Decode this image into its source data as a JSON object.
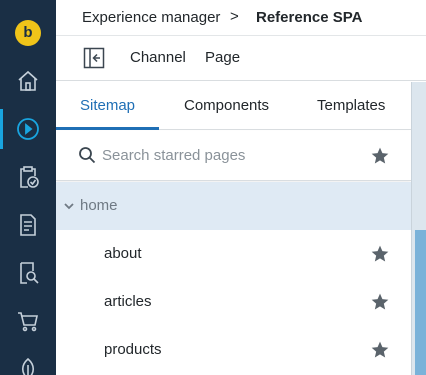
{
  "nav": {
    "logo_letter": "b",
    "items": [
      {
        "icon": "home-icon"
      },
      {
        "icon": "play-icon",
        "active": true
      },
      {
        "icon": "clipboard-check-icon"
      },
      {
        "icon": "document-icon"
      },
      {
        "icon": "document-search-icon"
      },
      {
        "icon": "cart-icon"
      },
      {
        "icon": "leaf-icon"
      }
    ]
  },
  "breadcrumb": {
    "first": "Experience manager",
    "separator": ">",
    "last": "Reference SPA"
  },
  "subbar": {
    "channel_label": "Channel",
    "page_label": "Page"
  },
  "tabs": {
    "sitemap": "Sitemap",
    "components": "Components",
    "templates": "Templates",
    "active": "sitemap"
  },
  "search": {
    "placeholder": "Search starred pages"
  },
  "tree": {
    "root": "home",
    "children": [
      "about",
      "articles",
      "products"
    ]
  },
  "colors": {
    "nav_bg": "#1a2f45",
    "accent": "#1f6fb5",
    "logo": "#f0c419",
    "selected_row": "#dfeaf4"
  }
}
